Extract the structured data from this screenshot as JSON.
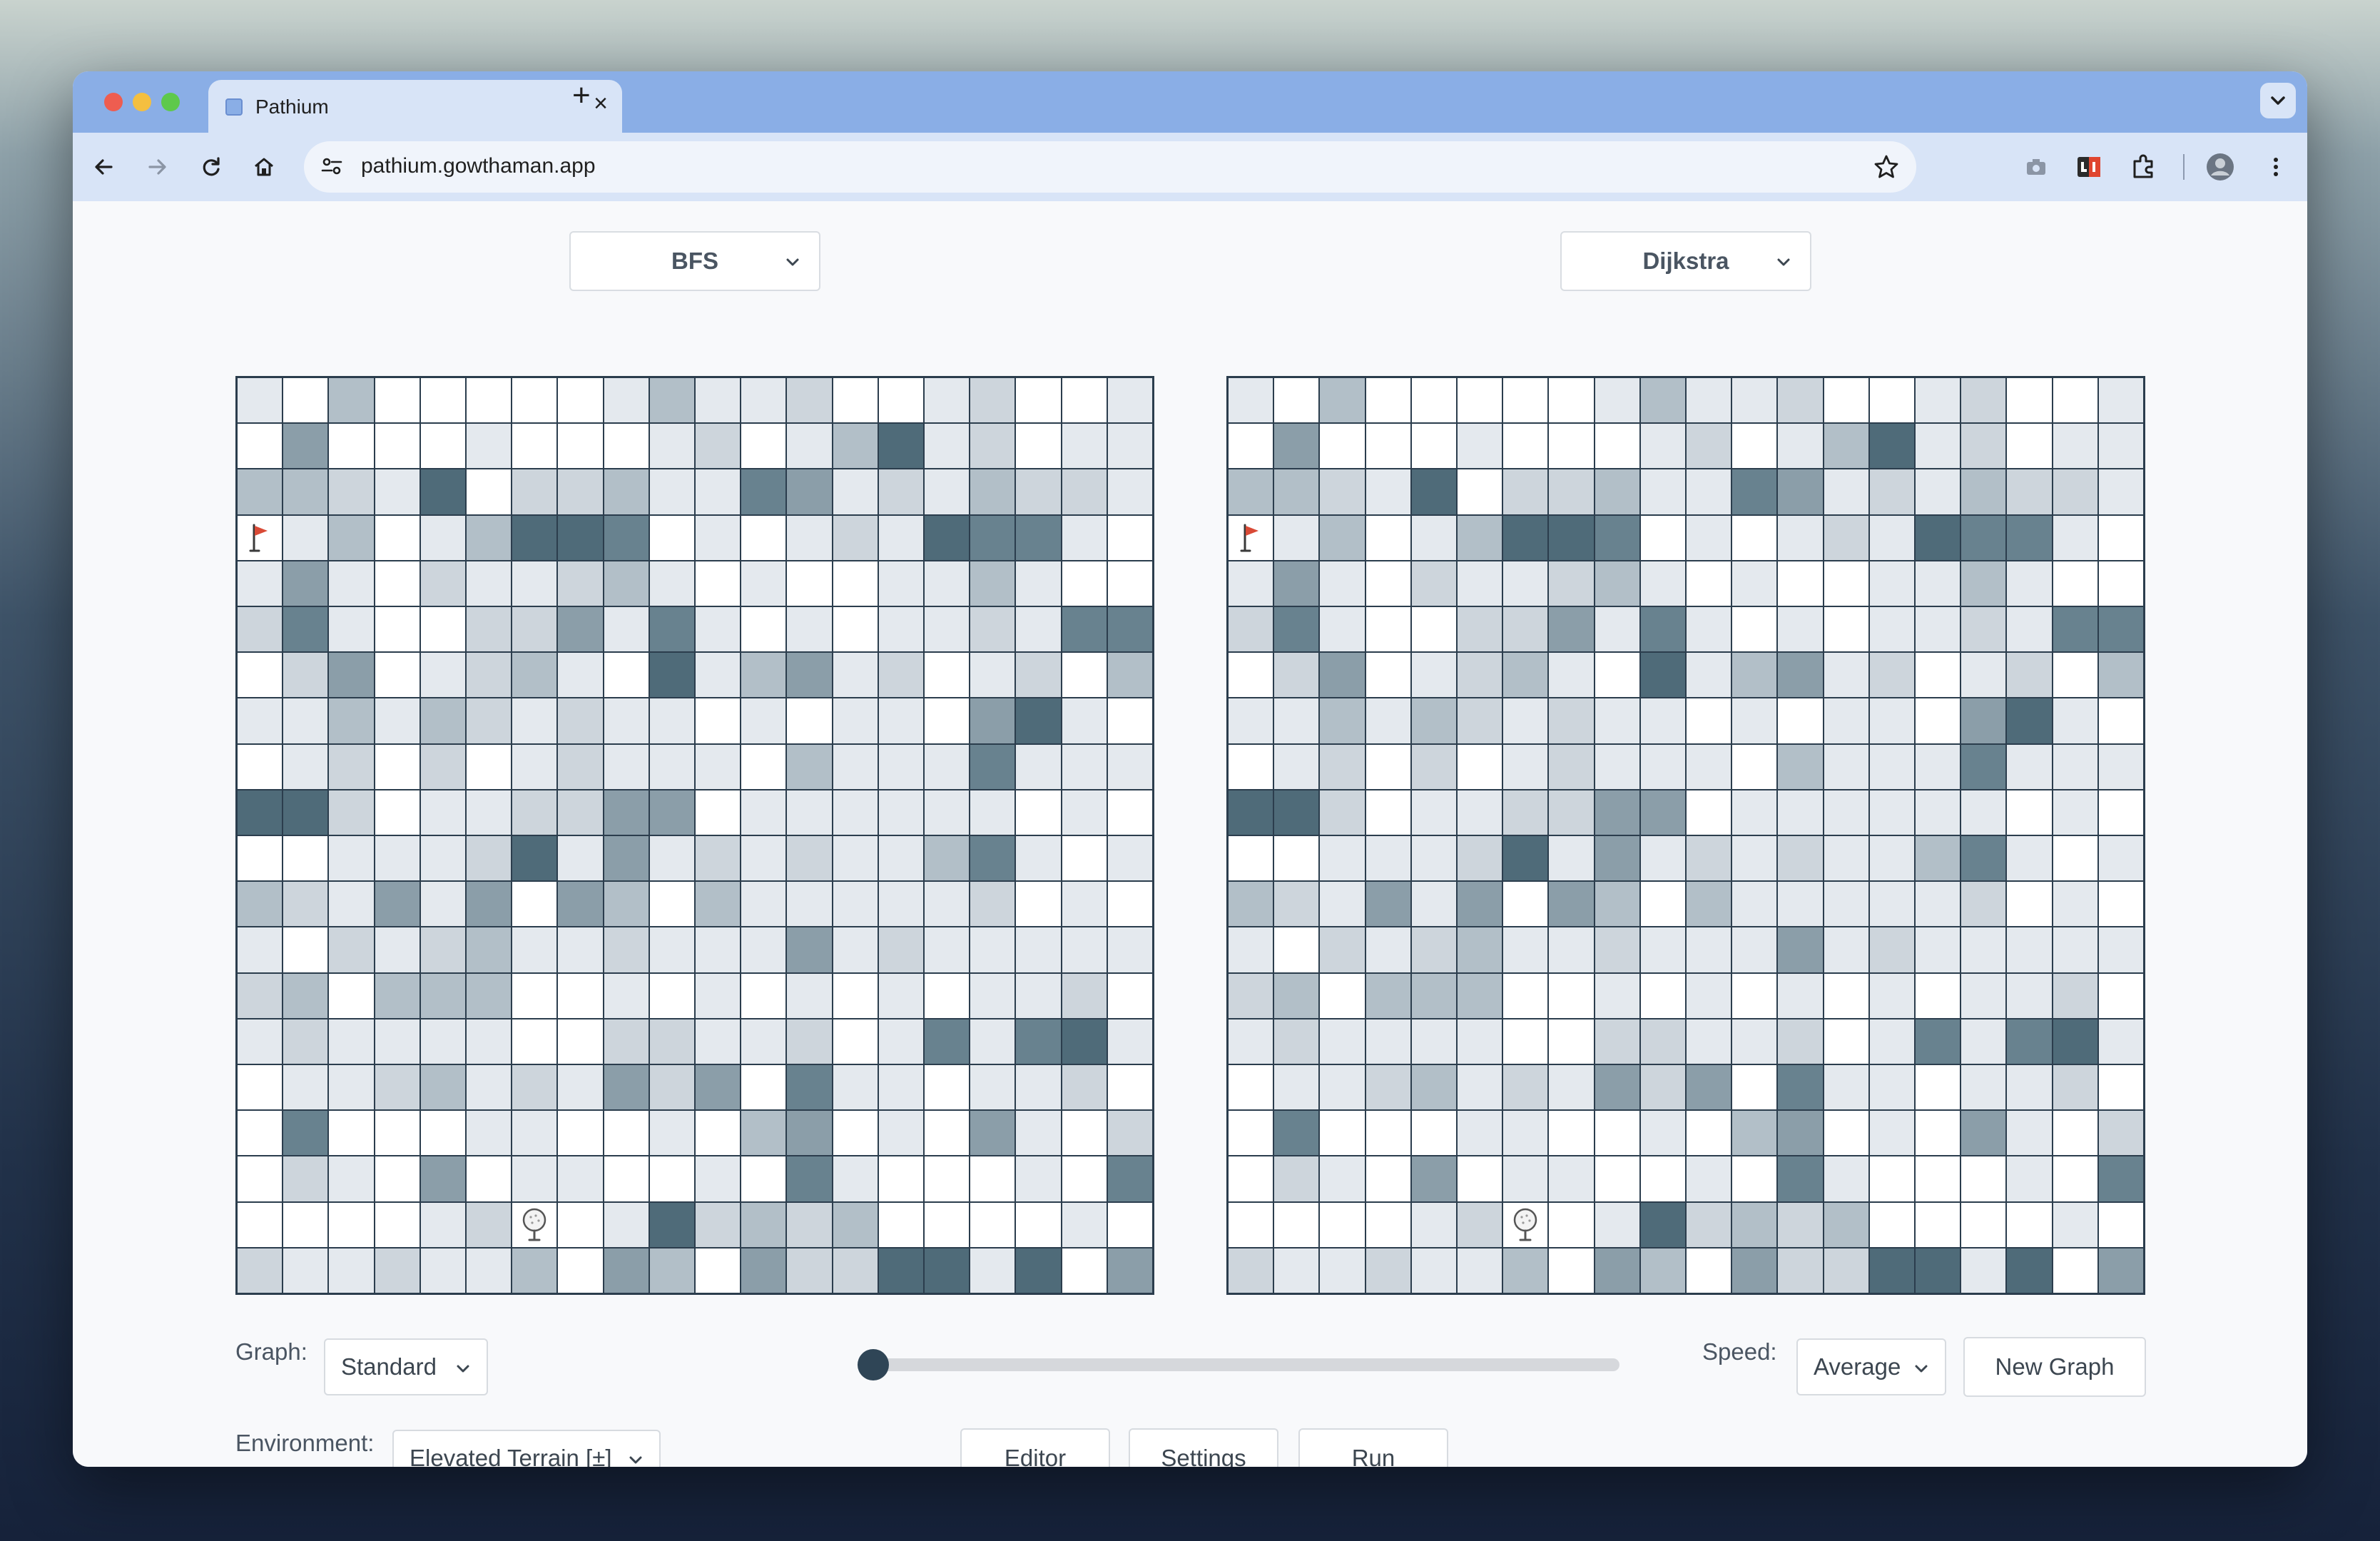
{
  "browser": {
    "tab_title": "Pathium",
    "url": "pathium.gowthaman.app",
    "traffic_light_colors": [
      "#ee5d50",
      "#f4bf40",
      "#5ec94b"
    ]
  },
  "algorithms": {
    "left": "BFS",
    "right": "Dijkstra"
  },
  "controls": {
    "graph_label": "Graph:",
    "graph_value": "Standard",
    "environment_label": "Environment:",
    "environment_value": "Elevated Terrain [±]",
    "speed_label": "Speed:",
    "speed_value": "Average",
    "new_graph_label": "New Graph",
    "editor_label": "Editor",
    "settings_label": "Settings",
    "run_label": "Run",
    "progress_fraction": 0
  },
  "grid": {
    "rows": 20,
    "cols": 20,
    "cell_colors": [
      "#ffffff",
      "#e4e9ee",
      "#cdd5dc",
      "#b2bfc8",
      "#8b9ea9",
      "#68828f",
      "#4f6b79"
    ],
    "start_cell": [
      3,
      0
    ],
    "goal_cell": [
      18,
      6
    ],
    "levels_left": [
      [
        1,
        0,
        3,
        0,
        0,
        0,
        0,
        0,
        1,
        3,
        1,
        1,
        2,
        0,
        0,
        1,
        2,
        0,
        0,
        1
      ],
      [
        0,
        4,
        0,
        0,
        0,
        1,
        0,
        0,
        0,
        1,
        2,
        0,
        1,
        3,
        6,
        1,
        2,
        0,
        1,
        1
      ],
      [
        3,
        3,
        2,
        1,
        6,
        0,
        2,
        2,
        3,
        1,
        1,
        5,
        4,
        1,
        2,
        1,
        3,
        2,
        2,
        1
      ],
      [
        0,
        1,
        3,
        0,
        1,
        3,
        6,
        6,
        5,
        0,
        1,
        0,
        1,
        2,
        1,
        6,
        5,
        5,
        1,
        0
      ],
      [
        1,
        4,
        1,
        0,
        2,
        1,
        1,
        2,
        3,
        1,
        0,
        1,
        0,
        0,
        1,
        1,
        3,
        1,
        0,
        0
      ],
      [
        2,
        5,
        1,
        0,
        0,
        2,
        2,
        4,
        1,
        5,
        1,
        0,
        1,
        0,
        1,
        1,
        2,
        1,
        5,
        5
      ],
      [
        0,
        2,
        4,
        0,
        1,
        2,
        3,
        1,
        0,
        6,
        1,
        3,
        4,
        1,
        2,
        0,
        1,
        2,
        0,
        3
      ],
      [
        1,
        1,
        3,
        1,
        3,
        2,
        1,
        2,
        1,
        1,
        0,
        1,
        0,
        1,
        1,
        0,
        4,
        6,
        1,
        0
      ],
      [
        0,
        1,
        2,
        0,
        2,
        0,
        1,
        2,
        1,
        1,
        1,
        0,
        3,
        1,
        1,
        1,
        5,
        1,
        1,
        1
      ],
      [
        6,
        6,
        2,
        0,
        1,
        1,
        2,
        2,
        4,
        4,
        0,
        1,
        1,
        1,
        1,
        1,
        1,
        0,
        1,
        0
      ],
      [
        0,
        0,
        1,
        1,
        1,
        2,
        6,
        1,
        4,
        1,
        2,
        1,
        2,
        1,
        1,
        3,
        5,
        1,
        0,
        1
      ],
      [
        3,
        2,
        1,
        4,
        1,
        4,
        0,
        4,
        3,
        0,
        3,
        1,
        1,
        1,
        1,
        1,
        2,
        0,
        1,
        0
      ],
      [
        1,
        0,
        2,
        1,
        2,
        3,
        1,
        1,
        2,
        1,
        1,
        1,
        4,
        1,
        2,
        1,
        1,
        1,
        1,
        1
      ],
      [
        2,
        3,
        0,
        3,
        3,
        3,
        0,
        0,
        1,
        0,
        1,
        0,
        1,
        0,
        1,
        0,
        1,
        1,
        2,
        0
      ],
      [
        1,
        2,
        1,
        1,
        1,
        1,
        0,
        0,
        2,
        2,
        1,
        1,
        2,
        0,
        1,
        5,
        1,
        5,
        6,
        1
      ],
      [
        0,
        1,
        1,
        2,
        3,
        1,
        2,
        1,
        4,
        2,
        4,
        0,
        5,
        1,
        1,
        0,
        1,
        1,
        2,
        0
      ],
      [
        0,
        5,
        0,
        0,
        0,
        1,
        1,
        0,
        0,
        1,
        0,
        3,
        4,
        0,
        1,
        0,
        4,
        1,
        0,
        2
      ],
      [
        0,
        2,
        1,
        0,
        4,
        0,
        1,
        1,
        0,
        0,
        1,
        0,
        5,
        1,
        0,
        0,
        0,
        1,
        0,
        5
      ],
      [
        0,
        0,
        0,
        0,
        1,
        2,
        0,
        0,
        1,
        6,
        2,
        3,
        2,
        3,
        0,
        0,
        0,
        0,
        1,
        0
      ],
      [
        2,
        1,
        1,
        2,
        1,
        1,
        3,
        0,
        4,
        3,
        0,
        4,
        2,
        2,
        6,
        6,
        1,
        6,
        0,
        4
      ]
    ],
    "levels_right": [
      [
        1,
        0,
        3,
        0,
        0,
        0,
        0,
        0,
        1,
        3,
        1,
        1,
        2,
        0,
        0,
        1,
        2,
        0,
        0,
        1
      ],
      [
        0,
        4,
        0,
        0,
        0,
        1,
        0,
        0,
        0,
        1,
        2,
        0,
        1,
        3,
        6,
        1,
        2,
        0,
        1,
        1
      ],
      [
        3,
        3,
        2,
        1,
        6,
        0,
        2,
        2,
        3,
        1,
        1,
        5,
        4,
        1,
        2,
        1,
        3,
        2,
        2,
        1
      ],
      [
        0,
        1,
        3,
        0,
        1,
        3,
        6,
        6,
        5,
        0,
        1,
        0,
        1,
        2,
        1,
        6,
        5,
        5,
        1,
        0
      ],
      [
        1,
        4,
        1,
        0,
        2,
        1,
        1,
        2,
        3,
        1,
        0,
        1,
        0,
        0,
        1,
        1,
        3,
        1,
        0,
        0
      ],
      [
        2,
        5,
        1,
        0,
        0,
        2,
        2,
        4,
        1,
        5,
        1,
        0,
        1,
        0,
        1,
        1,
        2,
        1,
        5,
        5
      ],
      [
        0,
        2,
        4,
        0,
        1,
        2,
        3,
        1,
        0,
        6,
        1,
        3,
        4,
        1,
        2,
        0,
        1,
        2,
        0,
        3
      ],
      [
        1,
        1,
        3,
        1,
        3,
        2,
        1,
        2,
        1,
        1,
        0,
        1,
        0,
        1,
        1,
        0,
        4,
        6,
        1,
        0
      ],
      [
        0,
        1,
        2,
        0,
        2,
        0,
        1,
        2,
        1,
        1,
        1,
        0,
        3,
        1,
        1,
        1,
        5,
        1,
        1,
        1
      ],
      [
        6,
        6,
        2,
        0,
        1,
        1,
        2,
        2,
        4,
        4,
        0,
        1,
        1,
        1,
        1,
        1,
        1,
        0,
        1,
        0
      ],
      [
        0,
        0,
        1,
        1,
        1,
        2,
        6,
        1,
        4,
        1,
        2,
        1,
        2,
        1,
        1,
        3,
        5,
        1,
        0,
        1
      ],
      [
        3,
        2,
        1,
        4,
        1,
        4,
        0,
        4,
        3,
        0,
        3,
        1,
        1,
        1,
        1,
        1,
        2,
        0,
        1,
        0
      ],
      [
        1,
        0,
        2,
        1,
        2,
        3,
        1,
        1,
        2,
        1,
        1,
        1,
        4,
        1,
        2,
        1,
        1,
        1,
        1,
        1
      ],
      [
        2,
        3,
        0,
        3,
        3,
        3,
        0,
        0,
        1,
        0,
        1,
        0,
        1,
        0,
        1,
        0,
        1,
        1,
        2,
        0
      ],
      [
        1,
        2,
        1,
        1,
        1,
        1,
        0,
        0,
        2,
        2,
        1,
        1,
        2,
        0,
        1,
        5,
        1,
        5,
        6,
        1
      ],
      [
        0,
        1,
        1,
        2,
        3,
        1,
        2,
        1,
        4,
        2,
        4,
        0,
        5,
        1,
        1,
        0,
        1,
        1,
        2,
        0
      ],
      [
        0,
        5,
        0,
        0,
        0,
        1,
        1,
        0,
        0,
        1,
        0,
        3,
        4,
        0,
        1,
        0,
        4,
        1,
        0,
        2
      ],
      [
        0,
        2,
        1,
        0,
        4,
        0,
        1,
        1,
        0,
        0,
        1,
        0,
        5,
        1,
        0,
        0,
        0,
        1,
        0,
        5
      ],
      [
        0,
        0,
        0,
        0,
        1,
        2,
        0,
        0,
        1,
        6,
        2,
        3,
        2,
        3,
        0,
        0,
        0,
        0,
        1,
        0
      ],
      [
        2,
        1,
        1,
        2,
        1,
        1,
        3,
        0,
        4,
        3,
        0,
        4,
        2,
        2,
        6,
        6,
        1,
        6,
        0,
        4
      ]
    ]
  }
}
